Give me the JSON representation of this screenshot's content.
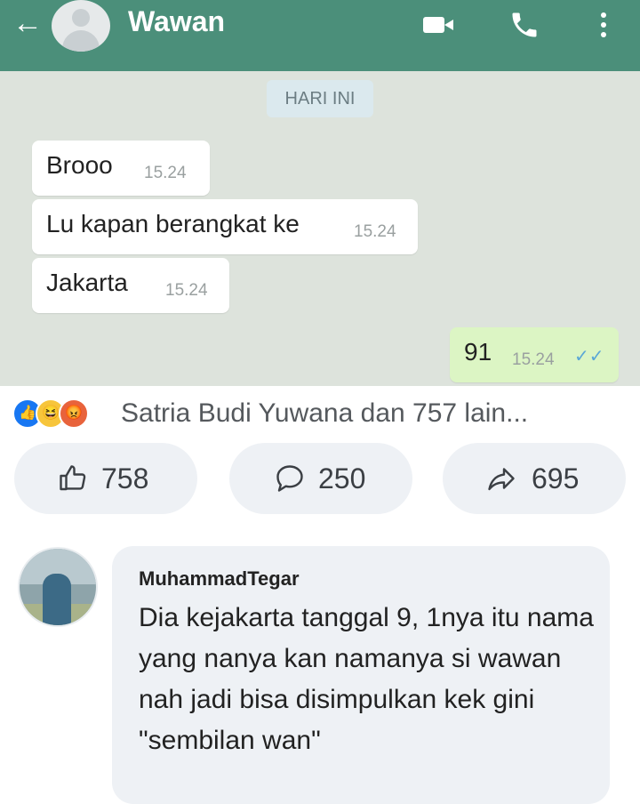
{
  "header": {
    "contact_name": "Wawan"
  },
  "chat": {
    "date_label": "HARI INI",
    "messages": [
      {
        "text": "Brooo",
        "time": "15.24",
        "direction": "in"
      },
      {
        "text": "Lu kapan berangkat ke",
        "time": "15.24",
        "direction": "in"
      },
      {
        "text": "Jakarta",
        "time": "15.24",
        "direction": "in"
      },
      {
        "text": "91",
        "time": "15.24",
        "direction": "out",
        "status": "read"
      }
    ]
  },
  "post": {
    "reactions_summary": "Satria Budi Yuwana dan 757 lain...",
    "like_count": "758",
    "comment_count": "250",
    "share_count": "695"
  },
  "comment": {
    "author": "MuhammadTegar",
    "text": "Dia kejakarta tanggal 9, 1nya itu nama yang nanya kan namanya si wawan nah jadi bisa disimpulkan kek gini \"sembilan wan\""
  },
  "colors": {
    "header_green": "#4b8f7a",
    "chat_bg": "#dde3dc",
    "outgoing_bubble": "#dcf5c4",
    "facebook_blue": "#1877f2"
  }
}
